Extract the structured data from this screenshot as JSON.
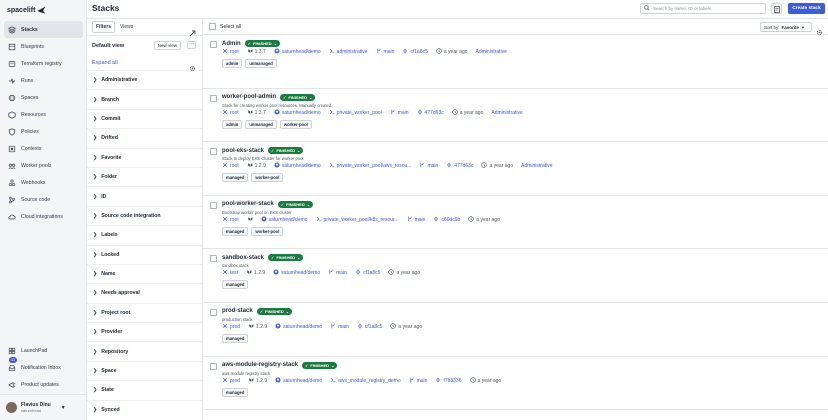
{
  "app": {
    "logo_text": "spacelift"
  },
  "nav": {
    "items": [
      {
        "label": "Stacks",
        "icon": "stacks-icon",
        "active": true
      },
      {
        "label": "Blueprints",
        "icon": "blueprint-icon"
      },
      {
        "label": "Terraform registry",
        "icon": "registry-icon"
      },
      {
        "label": "Runs",
        "icon": "runs-icon"
      },
      {
        "label": "Spaces",
        "icon": "spaces-icon"
      },
      {
        "label": "Resources",
        "icon": "resources-icon"
      },
      {
        "label": "Policies",
        "icon": "policies-icon"
      },
      {
        "label": "Contexts",
        "icon": "contexts-icon"
      },
      {
        "label": "Worker pools",
        "icon": "worker-pools-icon"
      },
      {
        "label": "Webhooks",
        "icon": "webhooks-icon"
      },
      {
        "label": "Source code",
        "icon": "source-code-icon"
      },
      {
        "label": "Cloud integrations",
        "icon": "cloud-icon"
      }
    ],
    "bottom": [
      {
        "label": "LaunchPad",
        "icon": "launchpad-icon"
      },
      {
        "label": "Notification Inbox",
        "icon": "inbox-icon"
      },
      {
        "label": "Product updates",
        "icon": "updates-icon"
      }
    ],
    "notification_count": "11",
    "user": {
      "name": "Flavius Dinu",
      "role": "saturnhead"
    }
  },
  "header": {
    "title": "Stacks",
    "search_placeholder": "Search by name, ID or labels",
    "create_label": "Create stack"
  },
  "filters": {
    "tabs": [
      "Filters",
      "Views"
    ],
    "view_title": "Default view",
    "new_view": "New view",
    "expand_all": "Expand all",
    "facets": [
      "Administrative",
      "Branch",
      "Commit",
      "Drifted",
      "Favorite",
      "Folder",
      "ID",
      "Source code integration",
      "Labels",
      "Locked",
      "Name",
      "Needs approval",
      "Project root",
      "Provider",
      "Repository",
      "Space",
      "State",
      "Synced"
    ]
  },
  "list": {
    "select_all": "Select all",
    "sort_prefix": "Sort by:",
    "sort_value": "Favorite",
    "stacks": [
      {
        "name": "Admin",
        "status": "FINISHED",
        "description": "",
        "space": "root",
        "version": "1.3.7",
        "repo": "saturnhead/demo",
        "project": "administrative",
        "branch": "main",
        "commit": "cf1a8c5",
        "time": "a year ago",
        "admin": "Administrative",
        "tags": [
          "admin",
          "unmanaged"
        ]
      },
      {
        "name": "worker-pool-admin",
        "status": "FINISHED",
        "description": "Stack for creating worker pool resources. Manually created.",
        "space": "root",
        "version": "1.3.7",
        "repo": "saturnhead/demo",
        "project": "private_worker_pool",
        "branch": "main",
        "commit": "477d63c",
        "time": "a year ago",
        "admin": "Administrative",
        "tags": [
          "admin",
          "unmanaged",
          "worker-pool"
        ]
      },
      {
        "name": "pool-eks-stack",
        "status": "FINISHED",
        "description": "Stack to deploy EKS Cluster for worker pool",
        "space": "root",
        "version": "1.2.9",
        "repo": "saturnhead/demo",
        "project": "private_worker_pool/aws_resou...",
        "branch": "main",
        "commit": "477d63c",
        "time": "a year ago",
        "admin": "Administrative",
        "tags": [
          "managed",
          "worker-pool"
        ]
      },
      {
        "name": "pool-worker-stack",
        "status": "FINISHED",
        "description": "Bootstrap worker pool on EKS cluster",
        "space": "root",
        "version": "",
        "repo": "saturnhead/demo",
        "project": "private_worker_pool/k8s_resour...",
        "branch": "main",
        "commit": "c60dc9b",
        "time": "a year ago",
        "admin": "",
        "tags": [
          "managed",
          "worker-pool"
        ]
      },
      {
        "name": "sandbox-stack",
        "status": "FINISHED",
        "description": "sandbox stack",
        "space": "test",
        "version": "1.2.9",
        "repo": "saturnhead/demo",
        "project": "",
        "branch": "main",
        "commit": "cf1a8c5",
        "time": "a year ago",
        "admin": "",
        "tags": [
          "managed"
        ]
      },
      {
        "name": "prod-stack",
        "status": "FINISHED",
        "description": "production stack",
        "space": "prod",
        "version": "1.2.9",
        "repo": "saturnhead/demo",
        "project": "",
        "branch": "main",
        "commit": "cf1a8c5",
        "time": "a year ago",
        "admin": "",
        "tags": [
          "managed"
        ]
      },
      {
        "name": "aws-module-registry-stack",
        "status": "FINISHED",
        "description": "aws module registry stack",
        "space": "prod",
        "version": "1.2.9",
        "repo": "saturnhead/demo",
        "project": "aws_module_registry_demo",
        "branch": "main",
        "commit": "f7b3336",
        "time": "a year ago",
        "admin": "",
        "tags": [
          "managed"
        ]
      }
    ]
  },
  "colors": {
    "accent": "#3e5bd9",
    "status_finished": "#1b7a3e",
    "sidebar_bg": "#f4f5f7"
  }
}
